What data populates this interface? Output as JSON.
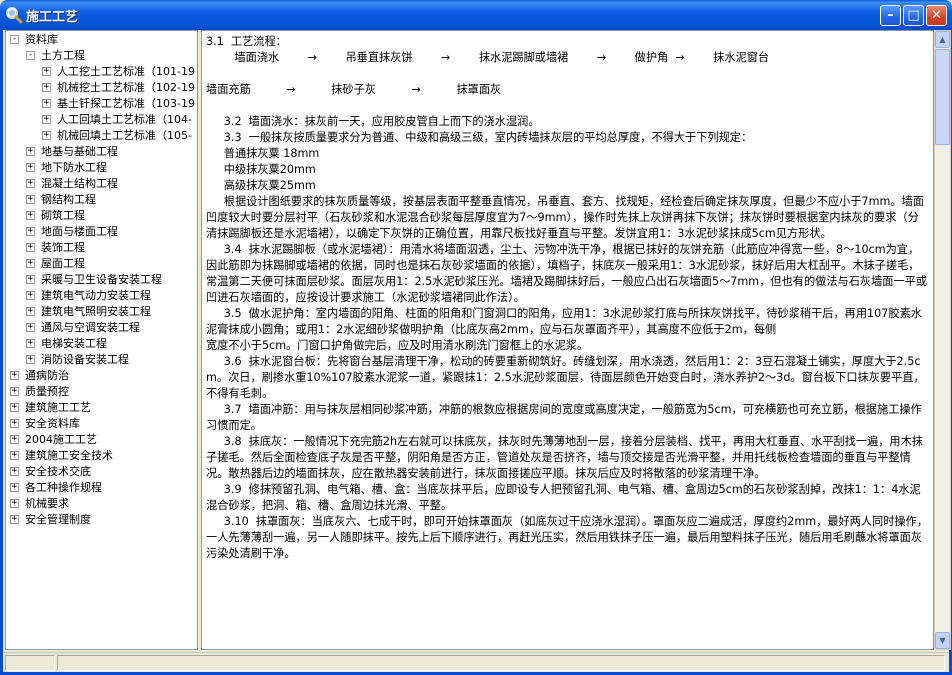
{
  "window": {
    "title": "施工工艺",
    "minimize": "–",
    "maximize": "□",
    "close": "✕"
  },
  "tree": {
    "root": "资料库",
    "items": [
      {
        "label": "土方工程",
        "level": 1,
        "sign": "-"
      },
      {
        "label": "人工挖土工艺标准（101-19",
        "level": 2,
        "sign": "+"
      },
      {
        "label": "机械挖土工艺标准（102-19",
        "level": 2,
        "sign": "+"
      },
      {
        "label": "基土钎探工艺标准（103-19",
        "level": 2,
        "sign": "+"
      },
      {
        "label": "人工回填土工艺标准（104-",
        "level": 2,
        "sign": "+"
      },
      {
        "label": "机械回填土工艺标准（105-",
        "level": 2,
        "sign": "+"
      },
      {
        "label": "地基与基础工程",
        "level": 1,
        "sign": "+"
      },
      {
        "label": "地下防水工程",
        "level": 1,
        "sign": "+"
      },
      {
        "label": "混凝土结构工程",
        "level": 1,
        "sign": "+"
      },
      {
        "label": "钢结构工程",
        "level": 1,
        "sign": "+"
      },
      {
        "label": "砌筑工程",
        "level": 1,
        "sign": "+"
      },
      {
        "label": "地面与楼面工程",
        "level": 1,
        "sign": "+"
      },
      {
        "label": "装饰工程",
        "level": 1,
        "sign": "+"
      },
      {
        "label": "屋面工程",
        "level": 1,
        "sign": "+"
      },
      {
        "label": "采暖与卫生设备安装工程",
        "level": 1,
        "sign": "+"
      },
      {
        "label": "建筑电气动力安装工程",
        "level": 1,
        "sign": "+"
      },
      {
        "label": "建筑电气照明安装工程",
        "level": 1,
        "sign": "+"
      },
      {
        "label": "通风与空调安装工程",
        "level": 1,
        "sign": "+"
      },
      {
        "label": "电梯安装工程",
        "level": 1,
        "sign": "+"
      },
      {
        "label": "消防设备安装工程",
        "level": 1,
        "sign": "+"
      },
      {
        "label": "通病防治",
        "level": 0,
        "sign": "+"
      },
      {
        "label": "质量预控",
        "level": 0,
        "sign": "+"
      },
      {
        "label": "建筑施工工艺",
        "level": 0,
        "sign": "+"
      },
      {
        "label": "安全资料库",
        "level": 0,
        "sign": "+"
      },
      {
        "label": "2004施工工艺",
        "level": 0,
        "sign": "+"
      },
      {
        "label": "建筑施工安全技术",
        "level": 0,
        "sign": "+"
      },
      {
        "label": "安全技术交底",
        "level": 0,
        "sign": "+"
      },
      {
        "label": "各工种操作规程",
        "level": 0,
        "sign": "+"
      },
      {
        "label": "机械要求",
        "level": 0,
        "sign": "+"
      },
      {
        "label": "安全管理制度",
        "level": 0,
        "sign": "+"
      }
    ]
  },
  "doc": {
    "lines": [
      "3.1  工艺流程：",
      "        墙面浇水        →        吊垂直抹灰饼        →        抹水泥踢脚或墙裙        →        做护角  →        抹水泥窗台",
      " ",
      "墙面充筋          →          抹砂子灰          →          抹罩面灰",
      " ",
      "     3.2  墙面浇水：抹灰前一天，应用胶皮管自上而下的浇水湿润。",
      "     3.3  一般抹灰按质量要求分为普通、中级和高级三级，室内砖墙抹灰层的平均总厚度，不得大于下列规定：",
      "     普通抹灰粟 18mm",
      "     中级抹灰粟20mm",
      "     高级抹灰粟25mm",
      "     根据设计图纸要求的抹灰质量等级，按基层表面平整垂直情况，吊垂直、套方、找规矩，经检查后确定抹灰厚度，但最少不应小于7mm。墙面凹度较大时要分层衬平（石灰砂浆和水泥混合砂浆每层厚度宜为7～9mm），操作时先抹上灰饼再抹下灰饼；抹灰饼时要根据室内抹灰的要求（分清抹踢脚板还是水泥墙裙），以确定下灰饼的正确位置，用靠尺板找好垂直与平整。发饼宜用1：3水泥砂浆抹成5cm见方形状。",
      "     3.4  抹水泥踢脚板（或水泥墙裙）：用清水将墙面泅透，尘土、污物冲洗干净，根据已抹好的灰饼充筋（此筋应冲得宽一些，8～10cm为宜，因此筋即为抹踢脚或墙裙的依据，同时也是抹石灰砂浆墙面的依据），填档子，抹底灰一般采用1：3水泥砂浆，抹好后用大杠刮平。木抹子搓毛，常温第二天便可抹面层砂浆。面层灰用1：2.5水泥砂浆压光。墙裙及踢脚抹好后，一般应凸出石灰墙面5～7mm，但也有的做法与石灰墙面一平或凹进石灰墙面的，应按设计要求施工（水泥砂浆墙裙同此作法）。",
      "     3.5  做水泥护角：室内墙面的阳角、柱面的阳角和门窗洞口的阳角，应用1：3水泥砂浆打底与所抹灰饼找平，待砂浆稍干后，再用107胶素水泥膏抹成小圆角；或用1：2水泥细砂浆做明护角（比底灰高2mm，应与石灰罩面齐平），其高度不应低于2m，每侧",
      "宽度不小于5cm。门窗口护角做完后，应及时用清水刷洗门窗框上的水泥浆。",
      "     3.6  抹水泥窗台板：先将窗台基层清理干净，松动的砖要重新砌筑好。砖缝划深，用水浇透，然后用1：2：3豆石混凝土铺实，厚度大于2.5cm。次日，刷掺水重10%107胶素水泥浆一道，紧跟抹1：2.5水泥砂浆面层，待面层颜色开始变白时，浇水养护2～3d。窗台板下口抹灰要平直，不得有毛刺。",
      "     3.7  墙面冲筋：用与抹灰层相同砂浆冲筋，冲筋的根数应根据房间的宽度或高度决定，一般筋宽为5cm，可充横筋也可充立筋，根据施工操作习惯而定。",
      "     3.8  抹底灰：一般情况下充完筋2h左右就可以抹底灰，抹灰时先薄薄地刮一层，接着分层装档、找平，再用大杠垂直、水平刮找一遍，用木抹子搓毛。然后全面检查底子灰是否平整，阴阳角是否方正，管道处灰是否挤齐，墙与顶交接是否光滑平整，并用托线板检查墙面的垂直与平整情况。散热器后边的墙面抹灰，应在散热器安装前进行，抹灰面接搓应平顺。抹灰后应及时将散落的砂浆清理干净。",
      "     3.9  修抹预留孔洞、电气箱、槽、盒：当底灰抹平后，应即设专人把预留孔洞、电气箱、槽、盒周边5cm的石灰砂浆刮掉，改抹1：1：4水泥混合砂浆，把洞、箱、槽、盒周边抹光滑、平整。",
      "     3.10  抹罩面灰：当底灰六、七成干时，即可开始抹罩面灰（如底灰过干应浇水湿润）。罩面灰应二遍成活，厚度约2mm，最好两人同时操作，一人先薄薄刮一遍，另一人随即抹平。按先上后下顺序进行，再赶光压实，然后用铁抹子压一遍，最后用塑料抹子压光，随后用毛刷蘸水将罩面灰污染处清刷干净。"
    ]
  },
  "scrollbar": {
    "up": "▲",
    "down": "▼"
  }
}
